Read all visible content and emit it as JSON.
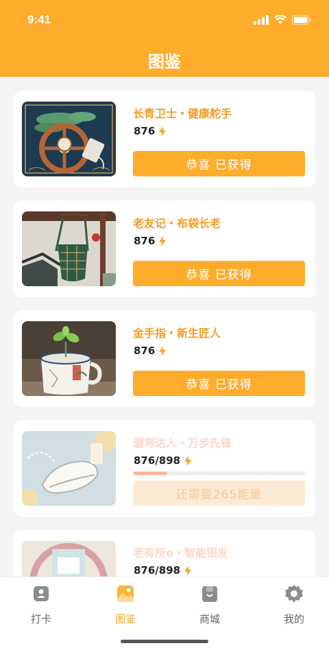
{
  "status_bar": {
    "time": "9:41"
  },
  "header": {
    "title": "图鉴"
  },
  "cards": [
    {
      "title": "长青卫士・健康舵手",
      "energy": "876",
      "button": "恭喜 已获得",
      "obtained": true
    },
    {
      "title": "老友记・布袋长老",
      "energy": "876",
      "button": "恭喜 已获得",
      "obtained": true
    },
    {
      "title": "金手指・新生匠人",
      "energy": "876",
      "button": "恭喜 已获得",
      "obtained": true
    },
    {
      "title": "遛弯达人・万步先锋",
      "energy": "876/898",
      "button": "还需要265能量",
      "obtained": false,
      "progress_percent": 20
    },
    {
      "title": "老有所e・智能银发",
      "energy": "876/898",
      "obtained": false
    }
  ],
  "tabbar": {
    "tabs": [
      {
        "label": "打卡",
        "icon": "checkin-icon",
        "active": false
      },
      {
        "label": "图鉴",
        "icon": "gallery-icon",
        "active": true
      },
      {
        "label": "商城",
        "icon": "store-icon",
        "active": false
      },
      {
        "label": "我的",
        "icon": "settings-icon",
        "active": false
      }
    ]
  },
  "colors": {
    "accent": "#fdac2c",
    "title_orange": "#f49c25",
    "locked_title": "#fcd7cc",
    "energy_bolt": "#f5a01a"
  }
}
